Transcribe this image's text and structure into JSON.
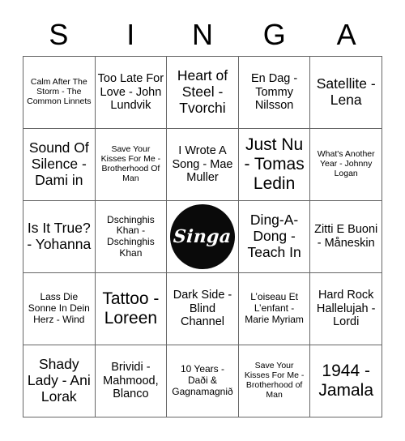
{
  "header": {
    "letters": [
      "S",
      "I",
      "N",
      "G",
      "A"
    ]
  },
  "grid": {
    "rows": 5,
    "columns": 5,
    "border_color": "#666666",
    "cells": [
      [
        {
          "text": "Calm After The Storm - The Common Linnets",
          "size": "xs"
        },
        {
          "text": "Too Late For Love - John Lundvik",
          "size": "md"
        },
        {
          "text": "Heart of Steel - Tvorchi",
          "size": "lg"
        },
        {
          "text": "En Dag - Tommy Nilsson",
          "size": "md"
        },
        {
          "text": "Satellite - Lena",
          "size": "lg"
        }
      ],
      [
        {
          "text": "Sound Of Silence - Dami in",
          "size": "lg"
        },
        {
          "text": "Save Your Kisses For Me - Brotherhood Of Man",
          "size": "xs"
        },
        {
          "text": "I Wrote A Song - Mae Muller",
          "size": "md"
        },
        {
          "text": "Just Nu - Tomas Ledin",
          "size": "xl"
        },
        {
          "text": "What's Another Year - Johnny Logan",
          "size": "xs"
        }
      ],
      [
        {
          "text": "Is It True? - Yohanna",
          "size": "lg"
        },
        {
          "text": "Dschinghis Khan - Dschinghis Khan",
          "size": "sm"
        },
        {
          "text": "",
          "size": "md",
          "free_space": true,
          "logo_label": "Singa",
          "logo_color": "#0a0a0a"
        },
        {
          "text": "Ding-A-Dong - Teach In",
          "size": "lg"
        },
        {
          "text": "Zitti E Buoni - Måneskin",
          "size": "md"
        }
      ],
      [
        {
          "text": "Lass Die Sonne In Dein Herz - Wind",
          "size": "sm"
        },
        {
          "text": "Tattoo - Loreen",
          "size": "xl"
        },
        {
          "text": "Dark Side - Blind Channel",
          "size": "md"
        },
        {
          "text": "L’oiseau Et L’enfant - Marie Myriam",
          "size": "sm"
        },
        {
          "text": "Hard Rock Hallelujah - Lordi",
          "size": "md"
        }
      ],
      [
        {
          "text": "Shady Lady - Ani Lorak",
          "size": "lg"
        },
        {
          "text": "Brividi - Mahmood, Blanco",
          "size": "md"
        },
        {
          "text": "10 Years - Daði & Gagnamagnið",
          "size": "sm"
        },
        {
          "text": "Save Your Kisses For Me - Brotherhood of Man",
          "size": "xs"
        },
        {
          "text": "1944 - Jamala",
          "size": "xl"
        }
      ]
    ]
  }
}
